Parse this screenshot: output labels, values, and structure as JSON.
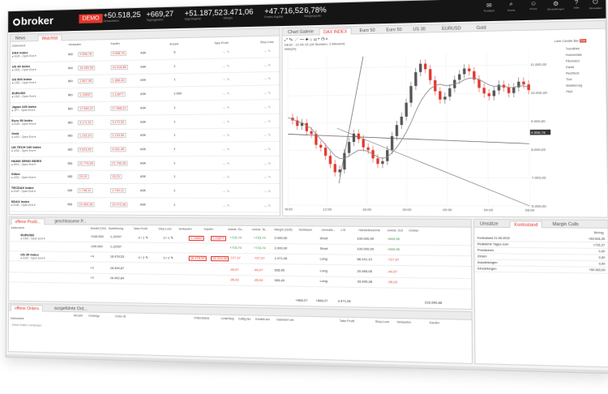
{
  "brand": {
    "name": "broker",
    "demo": "DEMO"
  },
  "tickers": [
    {
      "value": "+50.518,25",
      "label": "Gesamtwert"
    },
    {
      "value": "+669,27",
      "label": "Tagesgewinn"
    },
    {
      "value": "+51.187,52",
      "label": "Eigenkapital"
    },
    {
      "value": "3.471,06",
      "label": "Margin"
    },
    {
      "value": "+47.716,52",
      "label": "Freies Kapital"
    },
    {
      "value": "6,78%",
      "label": "Marginquote"
    }
  ],
  "toolbar_icons": [
    {
      "icon": "mail-icon",
      "label": "Postfach"
    },
    {
      "icon": "search-icon",
      "label": "Suche"
    },
    {
      "icon": "user-icon",
      "label": "Konto"
    },
    {
      "icon": "settings-icon",
      "label": "Einstellungen"
    },
    {
      "icon": "help-icon",
      "label": "Hilfe"
    },
    {
      "icon": "logout-icon",
      "label": "Abmelden"
    }
  ],
  "watchlist": {
    "tabs": [
      "News",
      "Watchlist"
    ],
    "headers": {
      "instrument": "Instrument",
      "sell": "Verkaufen",
      "buy": "Kaufen",
      "amount": "Anzahl",
      "tp": "Take-Profit",
      "sl": "Stop-Loss"
    },
    "rows": [
      {
        "name": "DAX Index",
        "sub": "EUR - Open End",
        "sell": "9.556,78",
        "buy": "9.558,78",
        "amount": "5"
      },
      {
        "name": "US 30 Index",
        "sub": "USD - Open End",
        "sell": "16.465,59",
        "buy": "16.418,86",
        "amount": "1"
      },
      {
        "name": "US 500 Index",
        "sub": "USD - Open End",
        "sell": "1.867,98",
        "buy": "1.868,43",
        "amount": "1"
      },
      {
        "name": "EURUSD",
        "sub": "USD - Open End",
        "sell": "1,13652",
        "buy": "1,13677",
        "amount": "1.000"
      },
      {
        "name": "Japan 225 Index",
        "sub": "JPY - Open End",
        "sell": "17.565,22",
        "buy": "17.668,22",
        "amount": "1"
      },
      {
        "name": "Euro 50 Index",
        "sub": "EUR - Open End",
        "sell": "3.171,52",
        "buy": "3.172,52",
        "amount": "1"
      },
      {
        "name": "Gold",
        "sub": "USD - Open End",
        "sell": "1.133,10",
        "buy": "1.133,50",
        "amount": "1"
      },
      {
        "name": "US TECH 100 Index",
        "sub": "USD - Open End",
        "sell": "4.523,45",
        "buy": "4.531,46",
        "amount": "1"
      },
      {
        "name": "HANG SENG INDEX",
        "sub": "HKD - Open End",
        "sell": "21.776,26",
        "buy": "21.790,26",
        "amount": "1"
      },
      {
        "name": "Silber",
        "sub": "USD - Open End",
        "sell": "15,19",
        "buy": "15,23",
        "amount": "1"
      },
      {
        "name": "TECDAX Index",
        "sub": "EUR - Open End",
        "sell": "1.748,11",
        "buy": "1.749,11",
        "amount": "1"
      },
      {
        "name": "SDAX Index",
        "sub": "EUR - Open End",
        "sell": "10.960,38",
        "buy": "10.973,38",
        "amount": "1"
      }
    ]
  },
  "chart_panel": {
    "tabs": [
      "Chart Galerie",
      "DAX INDEX",
      "Euro 50",
      "Euro 50",
      "US 30",
      "EURUSD",
      "Gold"
    ],
    "title": "DE30 - 21.06.15 (16 Stunden, 2 Minuten)",
    "legend_item": "SMA(20)",
    "indicators": [
      "Trendlinie",
      "Horizontale",
      "Fibonacci",
      "Kanal",
      "Rechteck",
      "Text",
      "Markierung",
      "Pfeil"
    ],
    "side_buttons": [
      "Linie",
      "Candle",
      "Bar",
      "Bar"
    ]
  },
  "chart_data": {
    "type": "line",
    "x_ticks": [
      "08:00",
      "12:00",
      "16:00",
      "20:00",
      "00:00",
      "04:00",
      "08:00"
    ],
    "y_ticks": [
      "11.000,00",
      "10.000,00",
      "9.000,00",
      "8.000,00",
      "7.000,00",
      "6.000,00"
    ],
    "price_tag": "9.556,78",
    "ylim": [
      6000,
      11500
    ],
    "series": [
      {
        "values": [
          9200,
          9100,
          8900,
          9000,
          8700,
          8600,
          8200,
          8100,
          7800,
          7500,
          7200,
          7300,
          7900,
          8300,
          8600,
          8400,
          8100,
          8000,
          7700,
          7500,
          7600,
          8000,
          8500,
          8900,
          9200,
          9700,
          10300,
          10800,
          11100,
          10900,
          10500,
          10100,
          9800,
          9900,
          10200,
          10500,
          10700,
          10900,
          10800,
          10500,
          10200,
          10000,
          9900,
          10100,
          10300,
          10200,
          10000,
          10200,
          10400,
          10300,
          10100
        ]
      },
      {
        "values": [
          9200,
          9150,
          9050,
          9020,
          8900,
          8800,
          8600,
          8400,
          8200,
          8000,
          7800,
          7700,
          7700,
          7800,
          7900,
          8000,
          8000,
          7950,
          7850,
          7750,
          7700,
          7750,
          7900,
          8100,
          8350,
          8650,
          9000,
          9400,
          9750,
          10000,
          10200,
          10300,
          10350,
          10300,
          10300,
          10350,
          10400,
          10500,
          10550,
          10550,
          10500,
          10400,
          10300,
          10250,
          10250,
          10250,
          10200,
          10200,
          10250,
          10250,
          10200
        ]
      }
    ]
  },
  "positions": {
    "tabs": [
      "offene Positi...",
      "geschlossene P..."
    ],
    "headers": [
      "Instrument",
      "Anzahl (Ort)",
      "Ausführung",
      "Take-Profit",
      "Stop-Loss",
      "Verkaufen",
      "Kaufen",
      "unreal. Gu...",
      "unreal. Ta...",
      "Margin (Gutt)",
      "Schlüssel",
      "Unrealis...",
      "L/S",
      "Handelssumme",
      "unreal. Gut",
      "Ordner"
    ],
    "rows": [
      {
        "name": "EURUSD",
        "sub": "USD - Open End",
        "amount": "+100.000",
        "exec": "1,12937",
        "tp": "0 / 1",
        "sl": "0 / 1",
        "sell": "1,13652",
        "buy": "1,13677",
        "pl1": "+715,74",
        "pl2": "+715,74",
        "margin": "2.000,00",
        "side": "Short",
        "total": "100.000,00",
        "pl3": "+603,90"
      },
      {
        "name": "",
        "sub": "",
        "amount": "-100.000",
        "exec": "1,12937",
        "tp": "",
        "sl": "",
        "sell": "",
        "buy": "",
        "pl1": "+715,74",
        "pl2": "+715,74",
        "margin": "2.000,00",
        "side": "Short",
        "total": "100.000,00",
        "pl3": "+603,90"
      },
      {
        "name": "US 30 Index",
        "sub": "USD - Open End",
        "amount": "+4",
        "exec": "16.478,53",
        "tp": "0 / 2",
        "sl": "0 / 2",
        "sell": "16.478,59",
        "buy": "16.414,48",
        "pl1": "-727,37",
        "pl2": "-727,37",
        "margin": "1.471,06",
        "side": "Long",
        "total": "66.141,10",
        "pl3": "-727,37"
      },
      {
        "name": "",
        "sub": "",
        "amount": "+2",
        "exec": "16.494,87",
        "tp": "",
        "sl": "",
        "sell": "",
        "buy": "",
        "pl1": "-40,07",
        "pl2": "-40,07",
        "margin": "595,45",
        "side": "Long",
        "total": "20.455,05",
        "pl3": "-40,07"
      },
      {
        "name": "",
        "sub": "",
        "amount": "+2",
        "exec": "16.492,84",
        "tp": "",
        "sl": "",
        "sell": "",
        "buy": "",
        "pl1": "-35,03",
        "pl2": "-35,03",
        "margin": "595,45",
        "side": "Long",
        "total": "33.495,38",
        "pl3": "-35,03"
      }
    ],
    "totals": {
      "pl1": "+666,07",
      "pl2": "+666,07",
      "margin": "3.471,06",
      "total": "233.990,88"
    }
  },
  "account": {
    "tabs": [
      "Umsätze",
      "Kontostand",
      "Margin Calls"
    ],
    "currency": "Betrag",
    "rows": [
      {
        "label": "Kontostand 21.06.2015",
        "value": "+50.515,25"
      },
      {
        "label": "Realisierte Tages-GuV",
        "value": "+715,27"
      },
      {
        "label": "Provisionen",
        "value": "0,00"
      },
      {
        "label": "Zinsen",
        "value": "0,00"
      },
      {
        "label": "Auszahlungen",
        "value": "0,00"
      },
      {
        "label": "Einzahlungen",
        "value": "+50.000,00"
      }
    ]
  },
  "orders": {
    "tabs": [
      "offene Orders",
      "ausgeführte Ord..."
    ],
    "headers": [
      "Instrument",
      "Anzahl",
      "Ordertyp",
      "Order ID",
      "Orderstatus",
      "Limit/Stop",
      "Gültig bis",
      "Erstellt am",
      "Geändert am",
      "Take-Profit",
      "Stop-Loss",
      "Verkaufen",
      "Kaufen"
    ],
    "empty": "Keine Daten vorhanden"
  }
}
